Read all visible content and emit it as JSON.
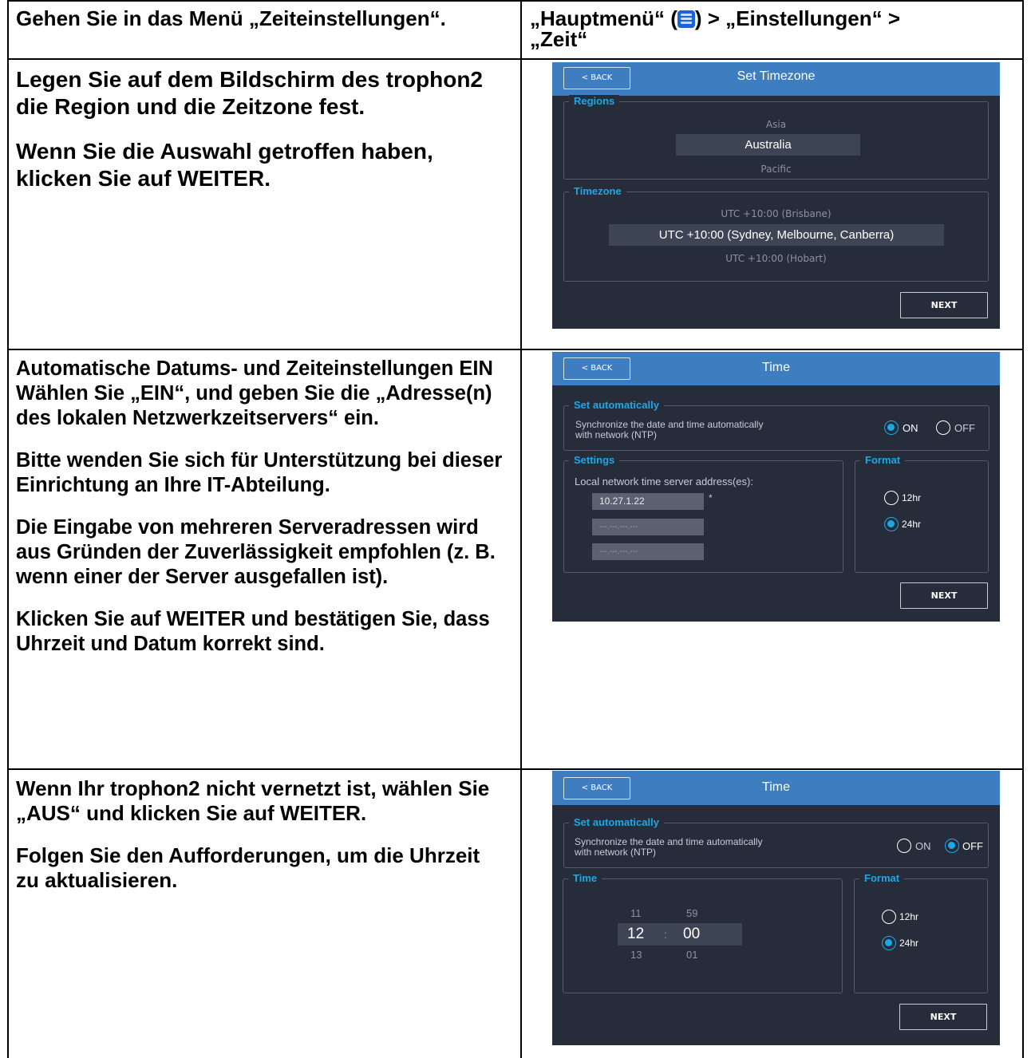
{
  "row1": {
    "left": "Gehen Sie in das Menü „Zeiteinstellungen“.",
    "right_before_icon": "„Hauptmenü“ (",
    "right_icon": "menu-icon",
    "right_after_icon": ") > „Einstellungen“ >",
    "right_line2": "„Zeit“"
  },
  "row2": {
    "p1": "Legen Sie auf dem Bildschirm des trophon2 die Region und die Zeitzone fest.",
    "p2": "Wenn Sie die Auswahl getroffen haben, klicken Sie auf WEITER.",
    "screen": {
      "back": "< BACK",
      "title": "Set Timezone",
      "regions_legend": "Regions",
      "regions": [
        "Asia",
        "Australia",
        "Pacific"
      ],
      "timezone_legend": "Timezone",
      "timezones": [
        "UTC +10:00 (Brisbane)",
        "UTC +10:00 (Sydney, Melbourne, Canberra)",
        "UTC +10:00 (Hobart)"
      ],
      "next": "NEXT"
    }
  },
  "row3": {
    "p1a": "Automatische Datums- und Zeiteinstellungen EIN",
    "p1b": "Wählen Sie „EIN“, und geben Sie die „Adresse(n) des lokalen Netzwerkzeitservers“ ein.",
    "p2": "Bitte wenden Sie sich für Unterstützung bei dieser Einrichtung an Ihre IT-Abteilung.",
    "p3": "Die Eingabe von mehreren Serveradressen wird aus Gründen der Zuverlässigkeit empfohlen (z. B. wenn einer der Server ausgefallen ist).",
    "p4": "Klicken Sie auf WEITER und bestätigen Sie, dass Uhrzeit und Datum korrekt sind.",
    "screen": {
      "back": "< BACK",
      "title": "Time",
      "auto_legend": "Set automatically",
      "sync_line1": "Synchronize the date and time automatically",
      "sync_line2": "with network (NTP)",
      "on": "ON",
      "off": "OFF",
      "settings_legend": "Settings",
      "server_label": "Local network time server address(es):",
      "server1": "10.27.1.22",
      "server_required": "*",
      "server2": "---.---.---.---",
      "server3": "---.---.---.---",
      "format_legend": "Format",
      "fmt12": "12hr",
      "fmt24": "24hr",
      "next": "NEXT"
    }
  },
  "row4": {
    "p1": "Wenn Ihr trophon2 nicht vernetzt ist, wählen Sie „AUS“ und klicken Sie auf WEITER.",
    "p2": "Folgen Sie den Aufforderungen, um die Uhrzeit zu aktualisieren.",
    "screen": {
      "back": "< BACK",
      "title": "Time",
      "auto_legend": "Set automatically",
      "sync_line1": "Synchronize the date and time automatically",
      "sync_line2": "with network (NTP)",
      "on": "ON",
      "off": "OFF",
      "time_legend": "Time",
      "hour_prev": "11",
      "hour": "12",
      "hour_next": "13",
      "sep": ":",
      "min_prev": "59",
      "min": "00",
      "min_next": "01",
      "format_legend": "Format",
      "fmt12": "12hr",
      "fmt24": "24hr",
      "next": "NEXT"
    }
  }
}
